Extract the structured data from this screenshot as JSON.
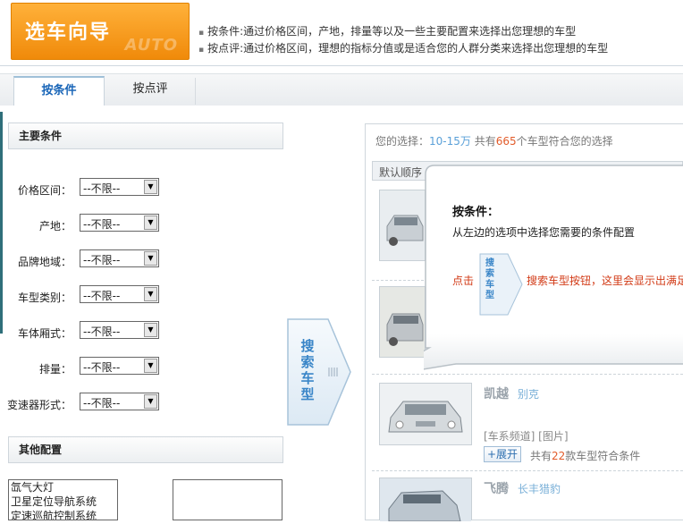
{
  "header": {
    "title": "选车向导",
    "watermark": "AUTO",
    "notes": [
      "按条件:通过价格区间，产地，排量等以及一些主要配置来选择出您理想的车型",
      "按点评:通过价格区间，理想的指标分值或是适合您的人群分类来选择出您理想的车型"
    ]
  },
  "tabs": [
    {
      "label": "按条件",
      "active": true
    },
    {
      "label": "按点评",
      "active": false
    }
  ],
  "main_conditions": {
    "heading": "主要条件",
    "filters": [
      {
        "label": "价格区间：",
        "value": "--不限--"
      },
      {
        "label": "产地：",
        "value": "--不限--"
      },
      {
        "label": "品牌地域：",
        "value": "--不限--"
      },
      {
        "label": "车型类别：",
        "value": "--不限--"
      },
      {
        "label": "车体厢式：",
        "value": "--不限--"
      },
      {
        "label": "排量：",
        "value": "--不限--"
      },
      {
        "label": "变速器形式：",
        "value": "--不限--"
      }
    ]
  },
  "other_config": {
    "heading": "其他配置",
    "options": [
      "氙气大灯",
      "卫星定位导航系统",
      "定速巡航控制系统"
    ]
  },
  "search_button": {
    "text": [
      "搜",
      "索",
      "车",
      "型"
    ]
  },
  "results": {
    "choice_prefix": "您的选择：",
    "choice_range": "10-15万",
    "choice_mid": "  共有",
    "choice_count": "665",
    "choice_suffix": "个车型符合您的选择",
    "sort_label": "默认顺序",
    "cars": [
      {
        "name": "凯越",
        "maker": "别克",
        "links": "[车系频道] [图片]",
        "expand": "+展开",
        "count_prefix": "共有",
        "count": "22",
        "count_suffix": "款车型符合条件"
      },
      {
        "name": "飞腾",
        "maker": "长丰猎豹"
      }
    ]
  },
  "popup": {
    "title": "按条件：",
    "description": "从左边的选项中选择您需要的条件配置",
    "click_label": "点击",
    "button_text": [
      "搜",
      "索",
      "车",
      "型"
    ],
    "hint": "搜索车型按钮，这里会显示出满足"
  },
  "colors": {
    "accent_orange": "#f08a0a",
    "link_blue": "#5aa0d8",
    "highlight_red": "#e25b2a",
    "tab_blue": "#1a66b8"
  }
}
